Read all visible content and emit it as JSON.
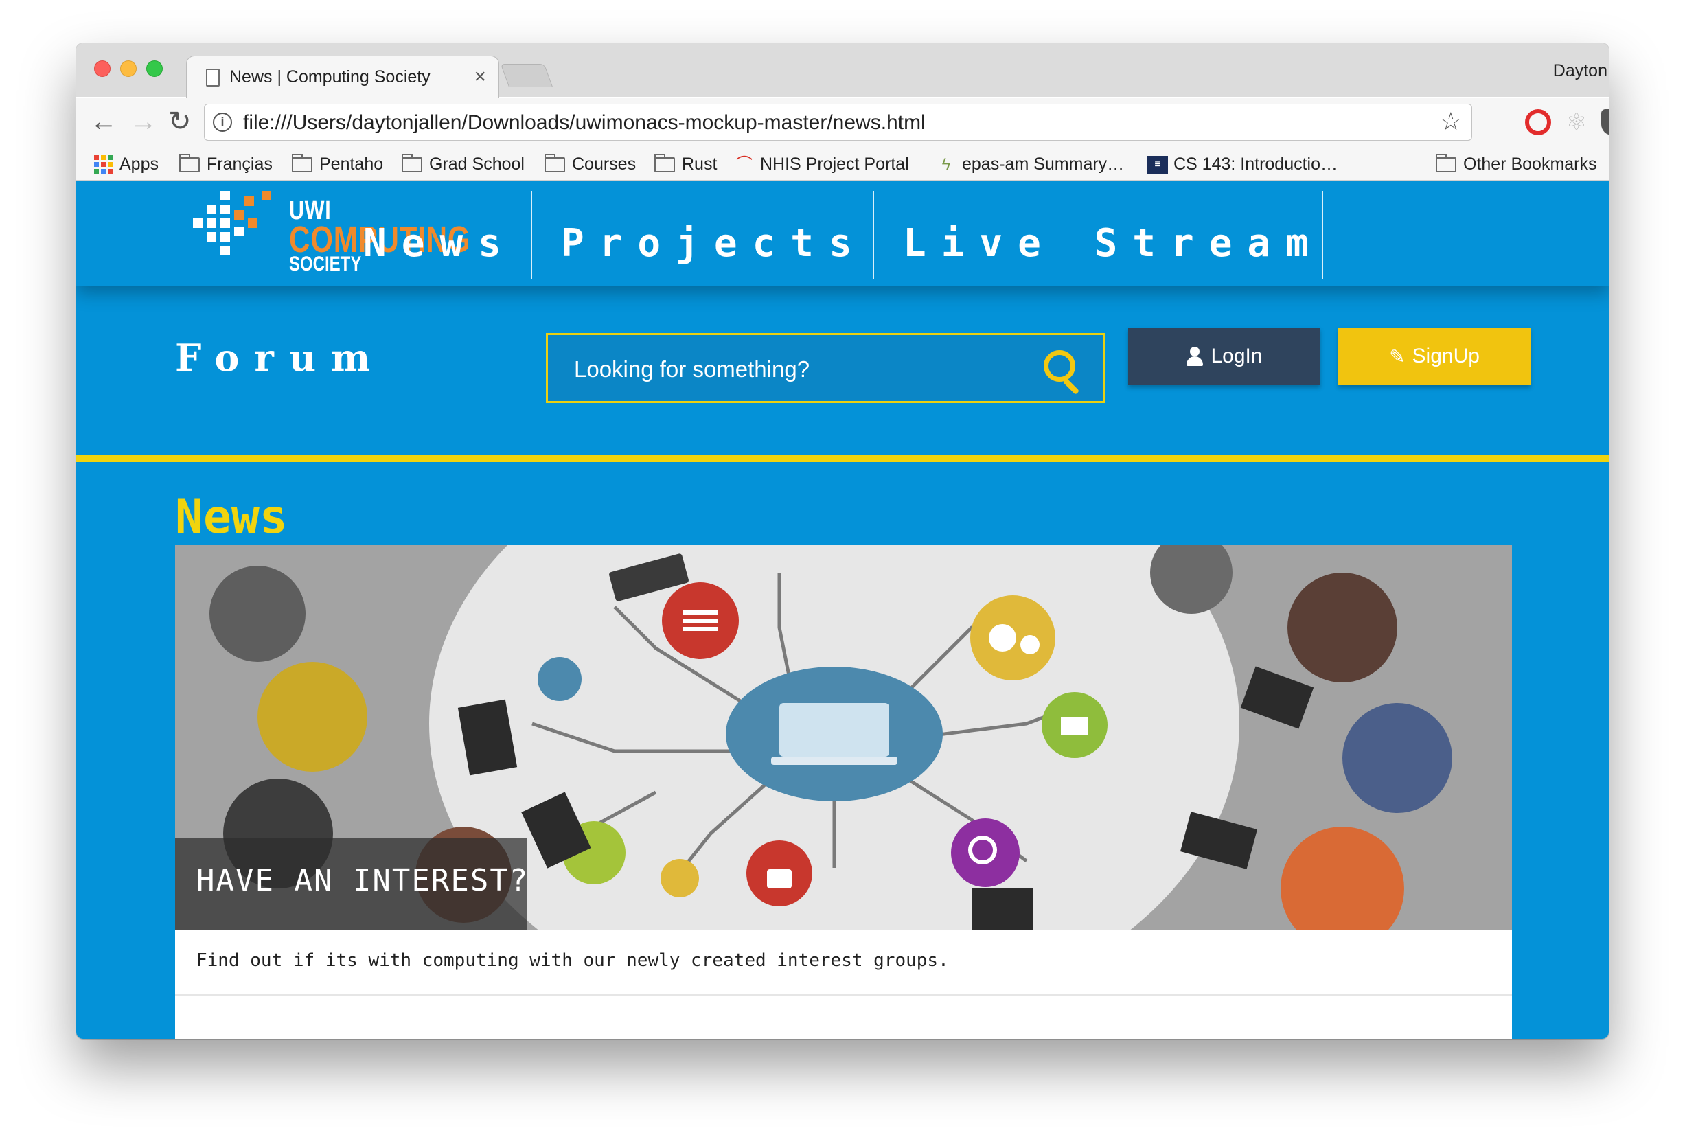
{
  "browser": {
    "tab_title": "News | Computing Society",
    "tab_close": "×",
    "profile_name": "Dayton",
    "url": "file:///Users/daytonjallen/Downloads/uwimonacs-mockup-master/news.html",
    "back": "←",
    "forward": "→",
    "reload": "↻",
    "info": "i",
    "star": "☆",
    "menu": "⋮",
    "bookmarks": [
      {
        "label": "Apps",
        "icon": "apps-grid-icon"
      },
      {
        "label": "Françias",
        "icon": "folder-icon"
      },
      {
        "label": "Pentaho",
        "icon": "folder-icon"
      },
      {
        "label": "Grad School",
        "icon": "folder-icon"
      },
      {
        "label": "Courses",
        "icon": "folder-icon"
      },
      {
        "label": "Rust",
        "icon": "folder-icon"
      },
      {
        "label": "NHIS Project Portal",
        "icon": "nhis-icon"
      },
      {
        "label": "epas-am Summary…",
        "icon": "epas-icon"
      },
      {
        "label": "CS 143: Introductio…",
        "icon": "cs143-icon"
      },
      {
        "label": "Other Bookmarks",
        "icon": "folder-icon"
      }
    ]
  },
  "site": {
    "logo": {
      "line1": "UWI",
      "line2": "COMPUTING",
      "line3": "SOCIETY"
    },
    "nav": [
      "News",
      "Projects",
      "Live Stream"
    ],
    "forum_title": "Forum",
    "search_placeholder": "Looking for something?",
    "login_label": "LogIn",
    "signup_label": "SignUp",
    "pencil": "✎",
    "news_heading": "News",
    "card": {
      "caption": "HAVE AN INTEREST?",
      "text": "Find out if its with computing with our newly created interest groups."
    }
  },
  "colors": {
    "page_blue": "#0492d8",
    "accent_yellow": "#f1d40e",
    "logo_orange": "#f08a2c",
    "login_bg": "#2f445d",
    "signup_bg": "#f1c40f"
  }
}
